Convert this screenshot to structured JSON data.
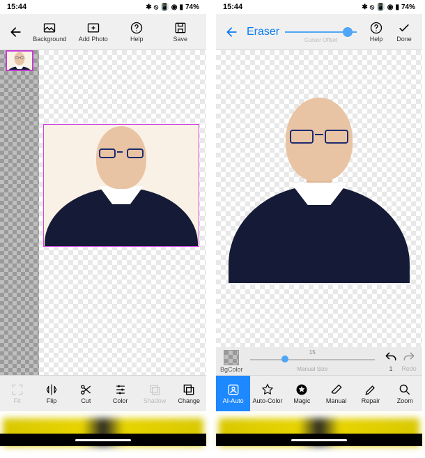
{
  "status": {
    "time": "15:44",
    "battery": "74%"
  },
  "left": {
    "toolbar": {
      "background": "Background",
      "add_photo": "Add Photo",
      "help": "Help",
      "save": "Save"
    },
    "bottom": {
      "fit": "Fit",
      "flip": "Flip",
      "cut": "Cut",
      "color": "Color",
      "shadow": "Shadow",
      "change": "Change"
    }
  },
  "right": {
    "title": "Eraser",
    "cursor_offset": "Cursor Offset",
    "toolbar": {
      "help": "Help",
      "done": "Done"
    },
    "brush": {
      "bgcolor": "BgColor",
      "manual_size": "Manual Size",
      "size_value": "15",
      "value": "1",
      "redo": "Redo"
    },
    "bottom": {
      "ai_auto": "AI-Auto",
      "auto_color": "Auto-Color",
      "magic": "Magic",
      "manual": "Manual",
      "repair": "Repair",
      "zoom": "Zoom"
    }
  }
}
